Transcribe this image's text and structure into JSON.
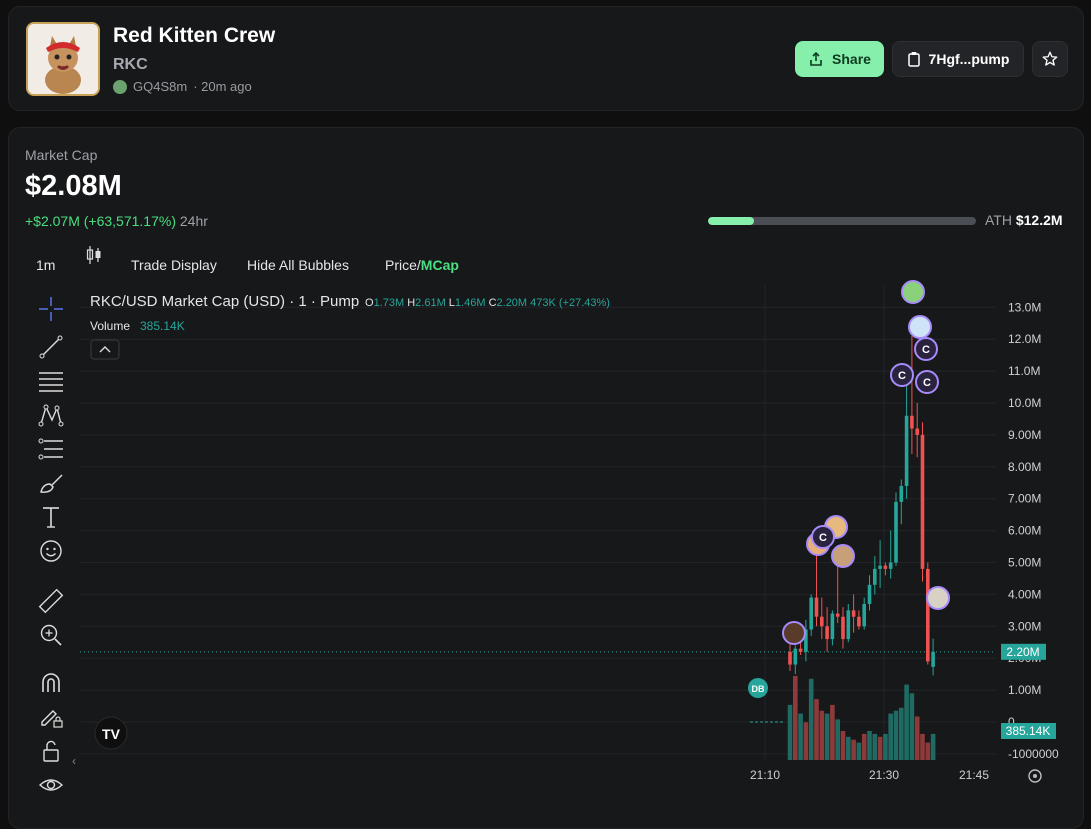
{
  "token": {
    "name": "Red Kitten Crew",
    "ticker": "RKC",
    "creator": "GQ4S8m",
    "age": "· 20m ago"
  },
  "actions": {
    "share_label": "Share",
    "contract_label": "7Hgf...pump",
    "star_icon": "star-icon"
  },
  "market": {
    "label": "Market Cap",
    "value": "$2.08M",
    "change": "+$2.07M (+63,571.17%)",
    "period": "24hr",
    "ath_label": "ATH",
    "ath_value": "$12.2M",
    "ath_progress": 0.17
  },
  "toolbar": {
    "interval": "1m",
    "trade_display": "Trade Display",
    "hide_bubbles": "Hide All Bubbles",
    "price": "Price/",
    "mcap": "MCap"
  },
  "legend": {
    "symbol": "RKC/USD Market Cap (USD) · 1 · Pump",
    "o_label": "O",
    "o": "1.73M",
    "h_label": "H",
    "h": "2.61M",
    "l_label": "L",
    "l": "1.46M",
    "c_label": "C",
    "c": "2.20M",
    "change": "473K (+27.43%)",
    "volume_label": "Volume",
    "volume_value": "385.14K"
  },
  "colors": {
    "up": "#26a69a",
    "down": "#ef5350",
    "accent": "#86efac"
  },
  "chart_data": {
    "type": "candlestick",
    "title": "RKC/USD Market Cap (USD) · 1 · Pump",
    "y_ticks": [
      "13.0M",
      "12.0M",
      "11.0M",
      "10.0M",
      "9.00M",
      "8.00M",
      "7.00M",
      "6.00M",
      "5.00M",
      "4.00M",
      "3.00M",
      "2.00M",
      "1.00M",
      "0",
      "-1000000"
    ],
    "x_ticks": [
      "21:10",
      "21:30",
      "21:45"
    ],
    "ylim": [
      -1000000,
      13000000
    ],
    "last_price_label": "2.20M",
    "last_volume_label": "385.14K",
    "candles": [
      {
        "o": 2.2,
        "h": 2.5,
        "l": 1.6,
        "c": 1.8
      },
      {
        "o": 1.8,
        "h": 2.4,
        "l": 1.5,
        "c": 2.3
      },
      {
        "o": 2.3,
        "h": 3.0,
        "l": 2.1,
        "c": 2.2
      },
      {
        "o": 2.2,
        "h": 3.2,
        "l": 1.9,
        "c": 2.9
      },
      {
        "o": 2.9,
        "h": 4.0,
        "l": 2.7,
        "c": 3.9
      },
      {
        "o": 3.9,
        "h": 5.3,
        "l": 3.0,
        "c": 3.3
      },
      {
        "o": 3.3,
        "h": 3.9,
        "l": 2.6,
        "c": 3.0
      },
      {
        "o": 3.0,
        "h": 3.6,
        "l": 2.2,
        "c": 2.6
      },
      {
        "o": 2.6,
        "h": 3.5,
        "l": 2.4,
        "c": 3.4
      },
      {
        "o": 3.4,
        "h": 5.4,
        "l": 3.1,
        "c": 3.3
      },
      {
        "o": 3.3,
        "h": 3.6,
        "l": 2.3,
        "c": 2.6
      },
      {
        "o": 2.6,
        "h": 3.7,
        "l": 2.5,
        "c": 3.5
      },
      {
        "o": 3.5,
        "h": 4.0,
        "l": 2.8,
        "c": 3.3
      },
      {
        "o": 3.3,
        "h": 3.5,
        "l": 2.9,
        "c": 3.0
      },
      {
        "o": 3.0,
        "h": 3.9,
        "l": 2.9,
        "c": 3.7
      },
      {
        "o": 3.7,
        "h": 4.6,
        "l": 3.5,
        "c": 4.3
      },
      {
        "o": 4.3,
        "h": 5.2,
        "l": 4.0,
        "c": 4.8
      },
      {
        "o": 4.8,
        "h": 5.7,
        "l": 4.2,
        "c": 4.9
      },
      {
        "o": 4.9,
        "h": 5.0,
        "l": 4.6,
        "c": 4.8
      },
      {
        "o": 4.8,
        "h": 6.0,
        "l": 4.5,
        "c": 5.0
      },
      {
        "o": 5.0,
        "h": 7.2,
        "l": 4.9,
        "c": 6.9
      },
      {
        "o": 6.9,
        "h": 7.6,
        "l": 6.2,
        "c": 7.4
      },
      {
        "o": 7.4,
        "h": 11.2,
        "l": 7.0,
        "c": 9.6
      },
      {
        "o": 9.6,
        "h": 12.1,
        "l": 8.4,
        "c": 9.2
      },
      {
        "o": 9.2,
        "h": 10.0,
        "l": 8.3,
        "c": 9.0
      },
      {
        "o": 9.0,
        "h": 9.4,
        "l": 4.4,
        "c": 4.8
      },
      {
        "o": 4.8,
        "h": 5.0,
        "l": 1.8,
        "c": 1.9
      },
      {
        "o": 1.73,
        "h": 2.61,
        "l": 1.46,
        "c": 2.2
      }
    ],
    "volume_up": [
      true,
      false,
      true,
      false,
      true,
      false,
      false,
      true,
      false,
      true,
      false,
      true,
      false,
      true,
      false,
      true,
      true,
      false,
      true,
      true,
      true,
      true,
      true,
      true,
      false,
      false,
      false,
      true
    ],
    "volume": [
      1.9,
      2.9,
      1.6,
      1.3,
      2.8,
      2.1,
      1.7,
      1.6,
      1.9,
      1.4,
      1.0,
      0.8,
      0.7,
      0.6,
      0.9,
      1.0,
      0.9,
      0.8,
      0.9,
      1.6,
      1.7,
      1.8,
      2.6,
      2.3,
      1.5,
      0.9,
      0.6,
      0.9
    ]
  }
}
